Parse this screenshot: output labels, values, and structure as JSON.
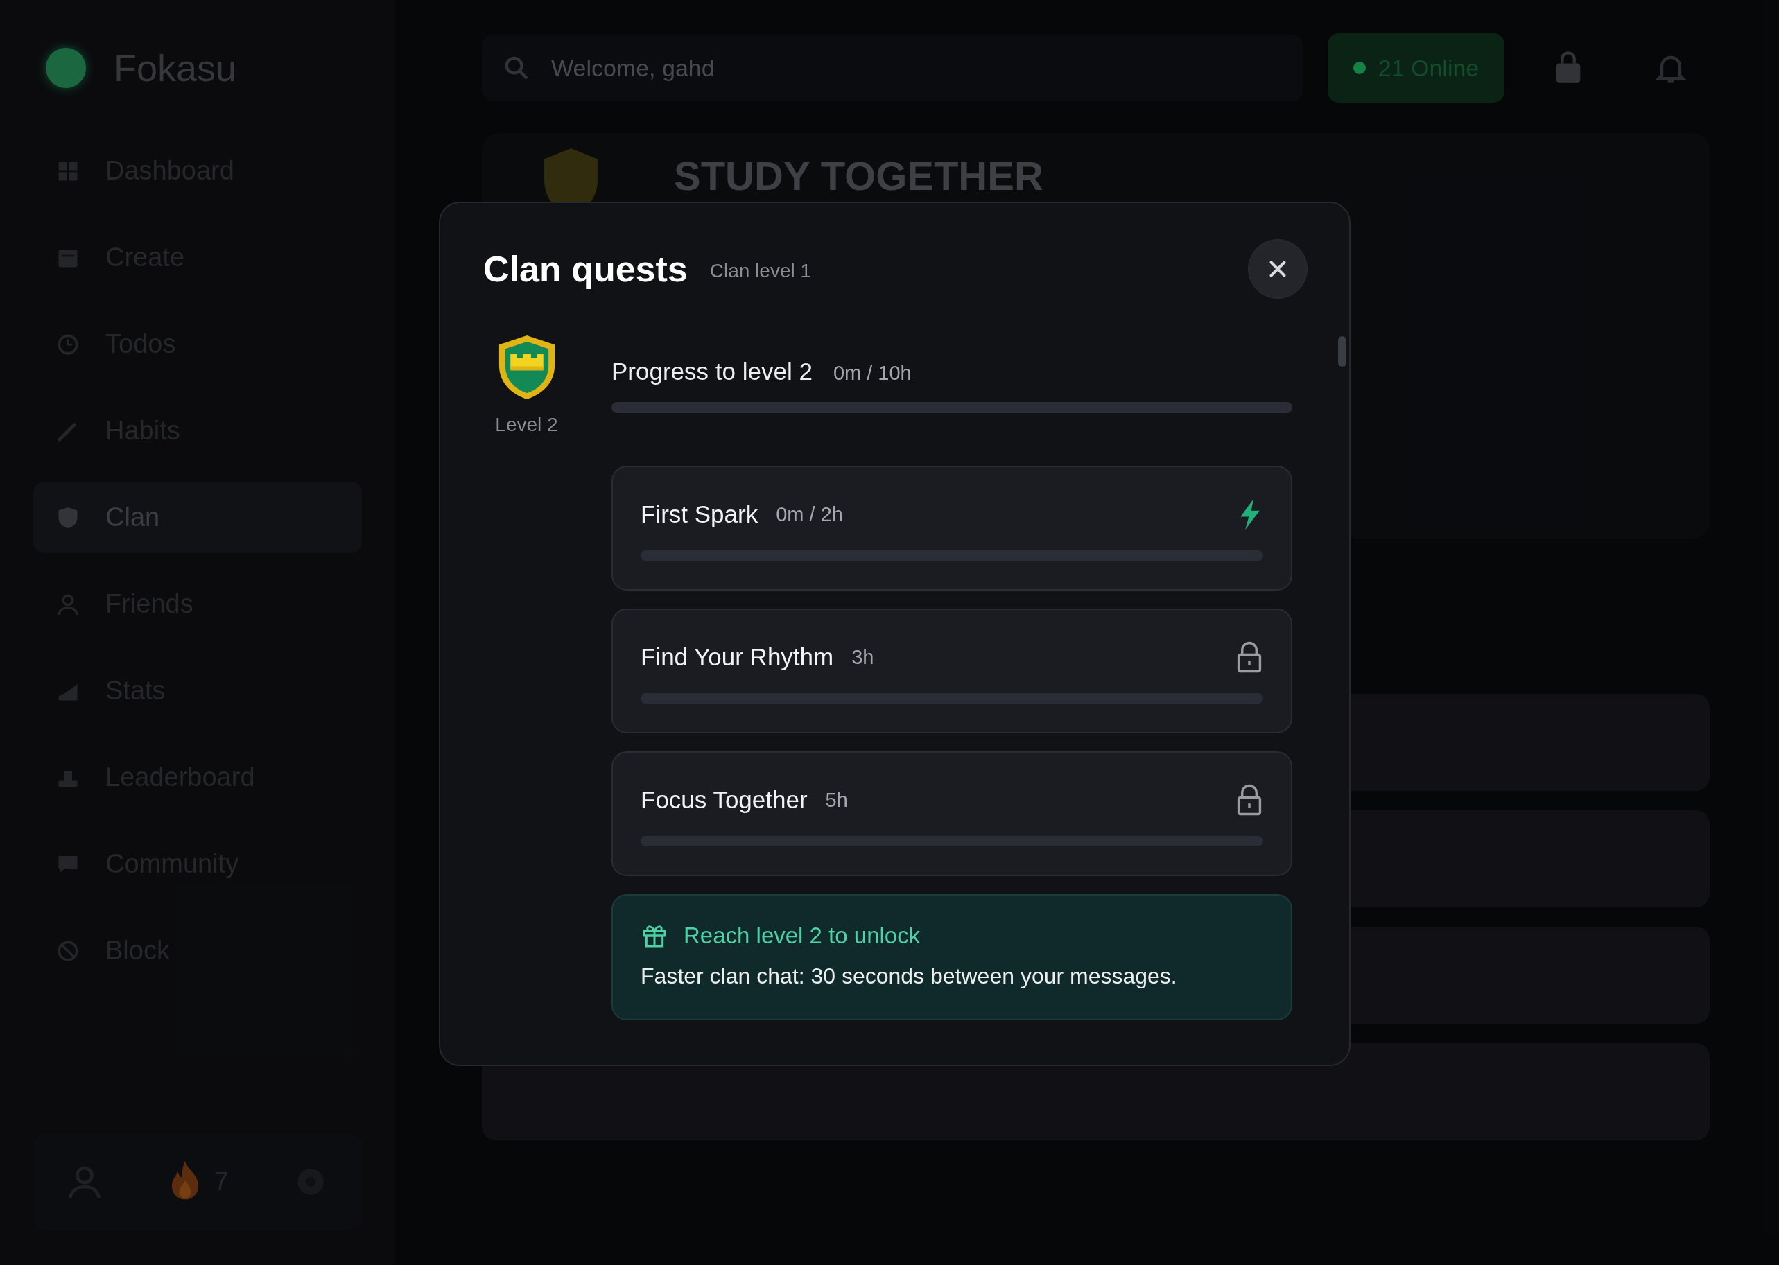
{
  "sidebar": {
    "logo": "Fokasu",
    "items": [
      {
        "label": "Dashboard",
        "selected": false
      },
      {
        "label": "Create",
        "selected": false
      },
      {
        "label": "Todos",
        "selected": false
      },
      {
        "label": "Habits",
        "selected": false
      },
      {
        "label": "Clan",
        "selected": true
      },
      {
        "label": "Friends",
        "selected": false
      },
      {
        "label": "Stats",
        "selected": false
      },
      {
        "label": "Leaderboard",
        "selected": false
      },
      {
        "label": "Community",
        "selected": false
      },
      {
        "label": "Block",
        "selected": false
      }
    ],
    "streak": "7"
  },
  "topbar": {
    "search": {
      "placeholder": "Welcome, gahd"
    },
    "online": "21 Online"
  },
  "banner": {
    "title": "STUDY TOGETHER"
  },
  "modal": {
    "title": "Clan quests",
    "subtitle": "Clan level 1",
    "badge": {
      "label": "Level 2"
    },
    "progress": {
      "label": "Progress to level 2",
      "reading": "0m / 10h",
      "level": 0
    },
    "quests": [
      {
        "name": "First Spark",
        "reading": "0m / 2h",
        "kind": "active",
        "level": 0
      },
      {
        "name": "Find Your Rhythm",
        "reading": "3h",
        "kind": "locked",
        "level": 0
      },
      {
        "name": "Focus Together",
        "reading": "5h",
        "kind": "locked",
        "level": 0
      }
    ],
    "reward": {
      "title": "Reach level 2 to unlock",
      "text": "Faster clan chat: 30 seconds between your messages."
    }
  }
}
